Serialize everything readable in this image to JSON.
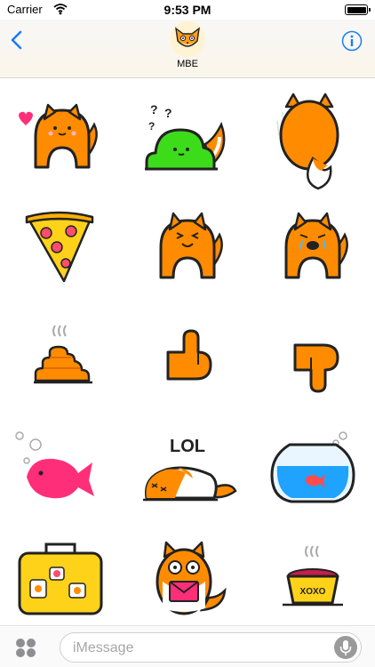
{
  "status": {
    "carrier": "Carrier",
    "time": "9:53 PM"
  },
  "header": {
    "contact_name": "MBE",
    "back_icon": "chevron-left-icon",
    "info_icon": "info-icon",
    "avatar_icon": "fox-face-icon"
  },
  "stickers": [
    {
      "name": "sticker-fox-heart"
    },
    {
      "name": "sticker-green-fox-question"
    },
    {
      "name": "sticker-fox-back"
    },
    {
      "name": "sticker-pizza"
    },
    {
      "name": "sticker-fox-happy"
    },
    {
      "name": "sticker-fox-crying"
    },
    {
      "name": "sticker-poop"
    },
    {
      "name": "sticker-thumbs-up"
    },
    {
      "name": "sticker-thumbs-down"
    },
    {
      "name": "sticker-pink-fish"
    },
    {
      "name": "sticker-fox-lol",
      "text": "LOL"
    },
    {
      "name": "sticker-fishbowl"
    },
    {
      "name": "sticker-suitcase"
    },
    {
      "name": "sticker-fox-letter"
    },
    {
      "name": "sticker-food-bowl",
      "text": "XOXO"
    }
  ],
  "input_bar": {
    "placeholder": "iMessage",
    "apps_icon": "app-grid-icon",
    "mic_icon": "microphone-icon"
  },
  "colors": {
    "orange": "#ff8c00",
    "accent_blue": "#1a7cf5",
    "green": "#3ddc1b",
    "yellow": "#ffd21a",
    "pink": "#ff2e78"
  }
}
